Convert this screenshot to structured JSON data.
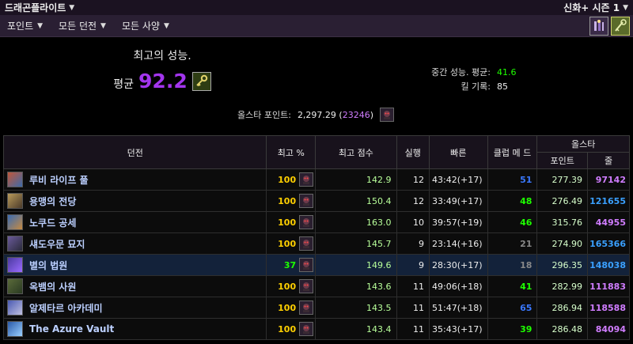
{
  "topbar": {
    "character": "드래곤플라이트",
    "season": "신화+ 시즌 1"
  },
  "filters": [
    {
      "label": "포인트"
    },
    {
      "label": "모든 던전"
    },
    {
      "label": "모든 사양"
    }
  ],
  "summary": {
    "heading": "최고의 성능.",
    "avg_label": "평균",
    "avg_value": "92.2",
    "median_label": "중간 성능. 평균:",
    "median_value": "41.6",
    "kills_label": "킬 기록:",
    "kills_value": "85",
    "allstar_label": "올스타 포인트:",
    "allstar_points": "2,297.29",
    "allstar_rank": "23246"
  },
  "table": {
    "headers": {
      "dungeon": "던전",
      "best_pct": "최고 %",
      "best_score": "최고 점수",
      "runs": "실행",
      "fastest": "빠른",
      "clear_med": "클럽 메 드",
      "allstar_group": "올스타",
      "points": "포인트",
      "rank": "줄"
    },
    "rows": [
      {
        "name": "루비 라이프 풀",
        "best": "100",
        "score": "142.9",
        "runs": "12",
        "fastest": "43:42(+17)",
        "clear": "51",
        "points": "277.39",
        "rank": "97142"
      },
      {
        "name": "용맹의 전당",
        "best": "100",
        "score": "150.4",
        "runs": "12",
        "fastest": "33:49(+17)",
        "clear": "48",
        "points": "276.49",
        "rank": "121655"
      },
      {
        "name": "노쿠드 공세",
        "best": "100",
        "score": "163.0",
        "runs": "10",
        "fastest": "39:57(+19)",
        "clear": "46",
        "points": "315.76",
        "rank": "44955"
      },
      {
        "name": "섀도우문 묘지",
        "best": "100",
        "score": "145.7",
        "runs": "9",
        "fastest": "23:14(+16)",
        "clear": "21",
        "points": "274.90",
        "rank": "165366"
      },
      {
        "name": "별의 법원",
        "best": "37",
        "score": "149.6",
        "runs": "9",
        "fastest": "28:30(+17)",
        "clear": "18",
        "points": "296.35",
        "rank": "148038"
      },
      {
        "name": "옥뱀의 사원",
        "best": "100",
        "score": "143.6",
        "runs": "11",
        "fastest": "49:06(+18)",
        "clear": "41",
        "points": "282.99",
        "rank": "111883"
      },
      {
        "name": "알제타르 아카데미",
        "best": "100",
        "score": "143.5",
        "runs": "11",
        "fastest": "51:47(+18)",
        "clear": "65",
        "points": "286.94",
        "rank": "118588"
      },
      {
        "name": "The Azure Vault",
        "best": "100",
        "score": "143.4",
        "runs": "11",
        "fastest": "35:43(+17)",
        "clear": "39",
        "points": "286.48",
        "rank": "84094"
      }
    ]
  },
  "colors": {
    "best_100": "#ffd000",
    "best_low": "#1eff00",
    "clear_blue": "#3a78ff",
    "clear_green": "#1eff00",
    "clear_gray": "#888888",
    "rank_purple": "#d07dff",
    "rank_blue": "#3aa0ff"
  },
  "icons": {
    "class_icons": [
      "priest-class-icon",
      "druid-class-icon"
    ],
    "key": "key-icon",
    "boss": "boss-portrait-icon"
  }
}
